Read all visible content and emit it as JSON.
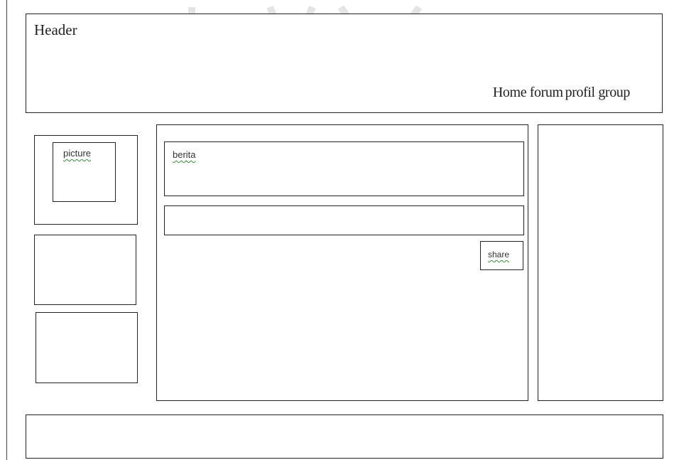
{
  "header": {
    "title": "Header",
    "nav": [
      "Home",
      "forum",
      "profil",
      "group"
    ]
  },
  "sidebar": {
    "picture_label": "picture"
  },
  "main": {
    "news_label": "berita",
    "post_input_value": "",
    "share_label": "share"
  },
  "colors": {
    "border": "#222222",
    "spellcheck_underline": "#3a8a3a"
  }
}
